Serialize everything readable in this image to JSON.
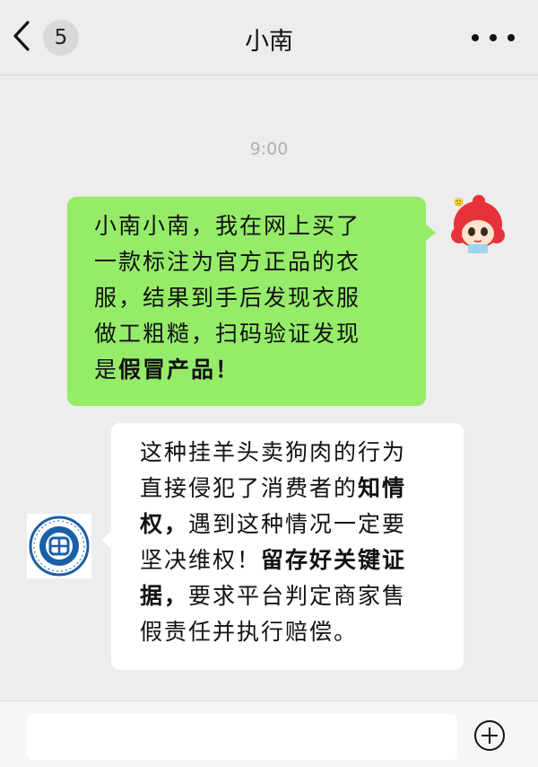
{
  "header": {
    "back_icon": "chevron-left-icon",
    "unread_count": "5",
    "title": "小南",
    "more_icon": "ellipsis-icon"
  },
  "timestamp": "9:00",
  "messages": [
    {
      "sender": "me",
      "avatar_icon": "cartoon-girl-avatar",
      "bubble_color": "#95ec69",
      "lines": [
        "小南小南，我在网上买了",
        "一款标注为官方正品的衣",
        "服，结果到手后发现衣服",
        "做工粗糙，扫码验证发现"
      ],
      "last_line_prefix": "是",
      "last_line_bold": "假冒产品！"
    },
    {
      "sender": "them",
      "avatar_icon": "university-logo-avatar",
      "bubble_color": "#ffffff",
      "line1": "这种挂羊头卖狗肉的行为",
      "line2_prefix": "直接侵犯了消费者的",
      "line2_bold": "知情",
      "line3_bold": "权，",
      "line3_rest": "遇到这种情况一定要",
      "line4_prefix": "坚决维权！",
      "line4_bold": "留存好关键证",
      "line5_bold": "据，",
      "line5_rest": "要求平台判定商家售",
      "line6": "假责任并执行赔偿。"
    }
  ],
  "input_bar": {
    "placeholder": "",
    "add_icon": "plus-circle-icon"
  },
  "colors": {
    "background": "#ededed",
    "my_bubble": "#95ec69",
    "their_bubble": "#ffffff",
    "logo_blue": "#1a5fa8"
  }
}
